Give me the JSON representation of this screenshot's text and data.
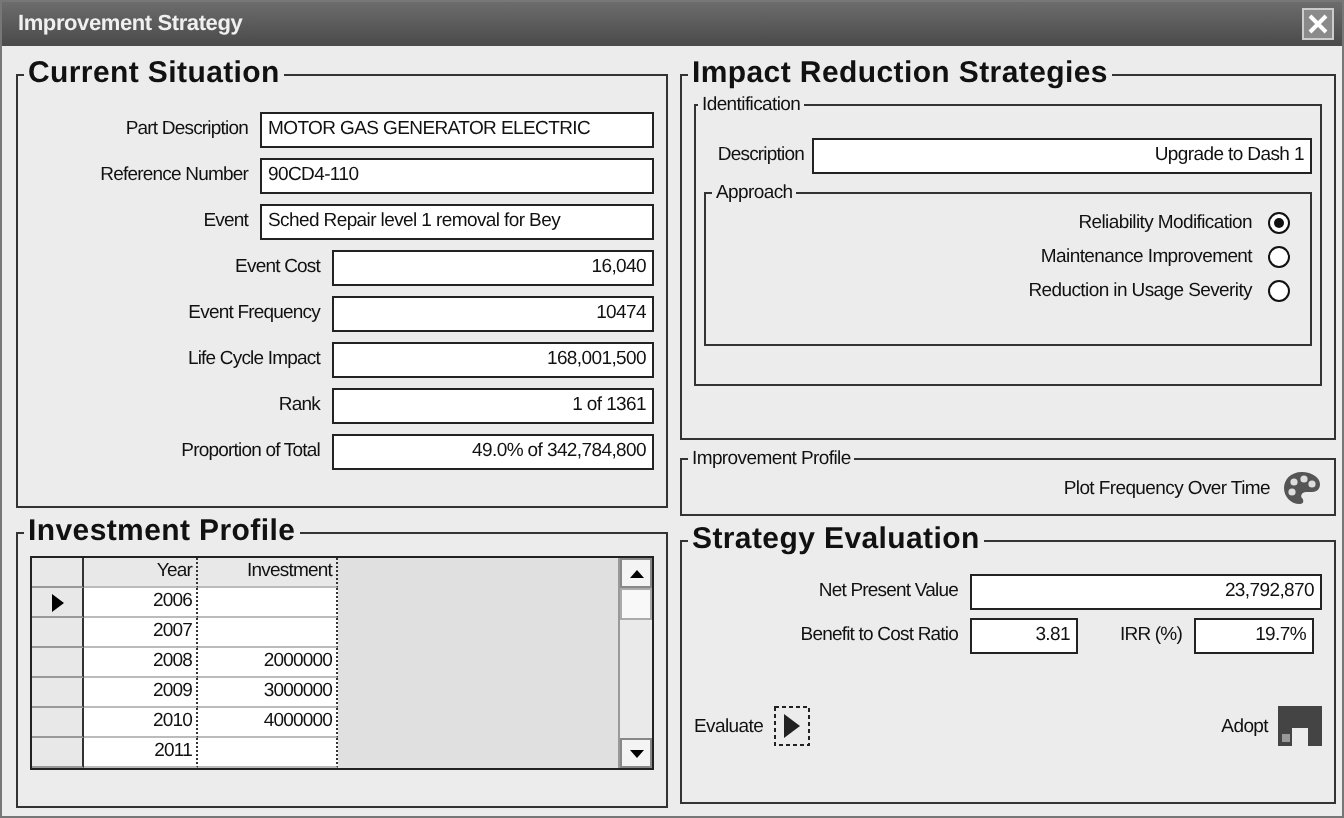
{
  "window": {
    "title": "Improvement Strategy"
  },
  "current_situation": {
    "title": "Current Situation",
    "fields": [
      {
        "label": "Part Description",
        "value": "MOTOR  GAS GENERATOR  ELECTRIC",
        "kind": "text"
      },
      {
        "label": "Reference Number",
        "value": "90CD4-110",
        "kind": "text"
      },
      {
        "label": "Event",
        "value": "Sched Repair level 1 removal for Bey",
        "kind": "text"
      },
      {
        "label": "Event Cost",
        "value": "16,040",
        "kind": "number"
      },
      {
        "label": "Event Frequency",
        "value": "10474",
        "kind": "number"
      },
      {
        "label": "Life Cycle Impact",
        "value": "168,001,500",
        "kind": "number"
      },
      {
        "label": "Rank",
        "value": "1 of 1361",
        "kind": "number"
      },
      {
        "label": "Proportion of Total",
        "value": "49.0% of 342,784,800",
        "kind": "number"
      }
    ]
  },
  "investment_profile": {
    "title": "Investment Profile",
    "columns": [
      "Year",
      "Investment"
    ],
    "rows": [
      {
        "year": "2006",
        "selected": true
      },
      {
        "year": "2007",
        "selected": false
      },
      {
        "year": "2008",
        "investment": "2000000",
        "selected": false
      },
      {
        "year": "2009",
        "investment": "3000000",
        "selected": false
      },
      {
        "year": "2010",
        "investment": "4000000",
        "selected": false
      },
      {
        "year": "2011",
        "selected": false
      }
    ]
  },
  "impact_reduction": {
    "title": "Impact Reduction Strategies",
    "identification": {
      "title": "Identification",
      "description_label": "Description",
      "description": "Upgrade to Dash 1"
    },
    "approach": {
      "title": "Approach",
      "options": [
        {
          "label": "Reliability Modification",
          "selected": true
        },
        {
          "label": "Maintenance Improvement",
          "selected": false
        },
        {
          "label": "Reduction in Usage Severity",
          "selected": false
        }
      ]
    }
  },
  "improvement_profile": {
    "title": "Improvement Profile",
    "action": "Plot Frequency Over Time"
  },
  "strategy_evaluation": {
    "title": "Strategy Evaluation",
    "npv_label": "Net Present Value",
    "npv": "23,792,870",
    "bcr_label": "Benefit to Cost Ratio",
    "bcr": "3.81",
    "irr_label": "IRR (%)",
    "irr": "19.7%",
    "evaluate": "Evaluate",
    "adopt": "Adopt"
  }
}
